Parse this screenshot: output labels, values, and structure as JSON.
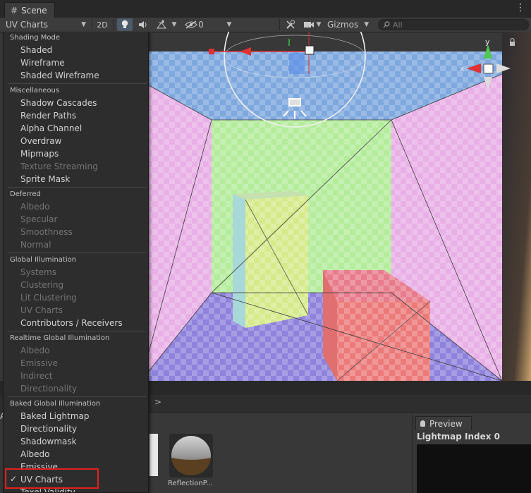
{
  "window": {
    "tab_title": "Scene",
    "menu_glyph": "⋮"
  },
  "toolbar": {
    "draw_mode": "UV Charts",
    "btn_2d": "2D",
    "hidden_count": "0",
    "gizmos_label": "Gizmos",
    "search_placeholder": "All"
  },
  "gizmo": {
    "y_label": "y",
    "x_label": "x"
  },
  "dropdown": {
    "shading_mode": {
      "header": "Shading Mode",
      "items": [
        "Shaded",
        "Wireframe",
        "Shaded Wireframe"
      ]
    },
    "miscellaneous": {
      "header": "Miscellaneous",
      "items": [
        "Shadow Cascades",
        "Render Paths",
        "Alpha Channel",
        "Overdraw",
        "Mipmaps",
        "Texture Streaming",
        "Sprite Mask"
      ]
    },
    "deferred": {
      "header": "Deferred",
      "items": [
        "Albedo",
        "Specular",
        "Smoothness",
        "Normal"
      ]
    },
    "global_illumination": {
      "header": "Global Illumination",
      "items": [
        "Systems",
        "Clustering",
        "Lit Clustering",
        "UV Charts",
        "Contributors / Receivers"
      ]
    },
    "realtime_gi": {
      "header": "Realtime Global Illumination",
      "items": [
        "Albedo",
        "Emissive",
        "Indirect",
        "Directionality"
      ]
    },
    "baked_gi": {
      "header": "Baked Global Illumination",
      "items": [
        "Baked Lightmap",
        "Directionality",
        "Shadowmask",
        "Albedo",
        "Emissive",
        "UV Charts",
        "Texel Validity"
      ]
    },
    "checkmark": "✓"
  },
  "project": {
    "breadcrumb_arrow": ">",
    "breadcrumb_a": "A",
    "reflection_label": "ReflectionP..."
  },
  "preview": {
    "tab_label": "Preview",
    "title": "Lightmap Index 0"
  },
  "colors": {
    "ceiling": "#7ea8de",
    "back_wall": "#b4ec9c",
    "side_walls": "#e8b0e6",
    "floor": "#8e82dc",
    "tall_box": "#d6ea8c",
    "red_box": "#ec7a7a",
    "highlight": "#e02020"
  }
}
